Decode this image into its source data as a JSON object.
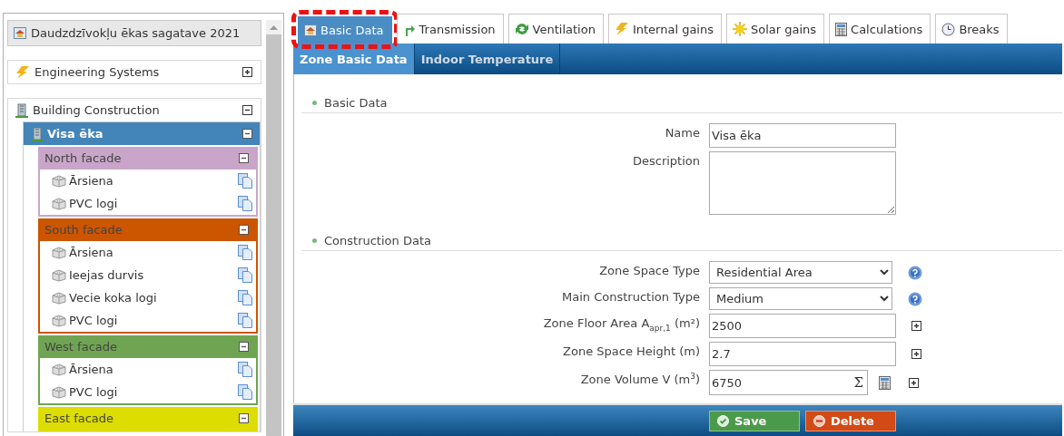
{
  "sidebar": {
    "project_button": "Daudzdzīvokļu ēkas sagatave 2021",
    "panels": [
      {
        "label": "Engineering Systems",
        "kind": "bolt",
        "expanded": false
      },
      {
        "label": "Building Construction",
        "kind": "building",
        "expanded": true,
        "children": [
          {
            "label": "Visa ēka",
            "color": "#4385b9",
            "expanded": true,
            "children": [
              {
                "label": "North facade",
                "color": "#c9a6c9",
                "expanded": true,
                "children": [
                  {
                    "label": "Ārsiena"
                  },
                  {
                    "label": "PVC logi"
                  }
                ]
              },
              {
                "label": "South facade",
                "color": "#cc5500",
                "expanded": true,
                "children": [
                  {
                    "label": "Ārsiena"
                  },
                  {
                    "label": "Ieejas durvis"
                  },
                  {
                    "label": "Vecie koka logi"
                  },
                  {
                    "label": "PVC logi"
                  }
                ]
              },
              {
                "label": "West facade",
                "color": "#6fa552",
                "expanded": true,
                "children": [
                  {
                    "label": "Ārsiena"
                  },
                  {
                    "label": "PVC logi"
                  }
                ]
              },
              {
                "label": "East facade",
                "color": "#dddd00",
                "expanded": true
              }
            ]
          }
        ]
      }
    ]
  },
  "tabs": [
    {
      "label": "Basic Data",
      "kind": "house",
      "selected": true,
      "highlighted": true
    },
    {
      "label": "Transmission",
      "kind": "turn",
      "selected": false,
      "highlighted": false
    },
    {
      "label": "Ventilation",
      "kind": "cycle",
      "selected": false,
      "highlighted": false
    },
    {
      "label": "Internal gains",
      "kind": "bolt",
      "selected": false,
      "highlighted": false
    },
    {
      "label": "Solar gains",
      "kind": "sun",
      "selected": false,
      "highlighted": false
    },
    {
      "label": "Calculations",
      "kind": "calc",
      "selected": false,
      "highlighted": false
    },
    {
      "label": "Breaks",
      "kind": "clock",
      "selected": false,
      "highlighted": false
    }
  ],
  "subtabs": [
    {
      "label": "Zone Basic Data",
      "selected": true
    },
    {
      "label": "Indoor Temperature",
      "selected": false
    }
  ],
  "sections": [
    {
      "title": "Basic Data",
      "fields": [
        {
          "kind": "text",
          "label": "Name",
          "value": "Visa ēka"
        },
        {
          "kind": "textarea",
          "label": "Description"
        }
      ]
    },
    {
      "title": "Construction Data",
      "fields": [
        {
          "kind": "select",
          "label": "Zone Space Type",
          "value": "Residential Area",
          "help": true
        },
        {
          "kind": "select",
          "label": "Main Construction Type",
          "value": "Medium",
          "help": true
        },
        {
          "kind": "text",
          "label": "Zone Floor Area A$_{apr,1}$ (m²)",
          "value": "2500",
          "expand": true
        },
        {
          "kind": "text",
          "label": "Zone Space Height (m)",
          "value": "2.7",
          "expand": true
        },
        {
          "kind": "formula",
          "label": "Zone Volume V (m$^{3}$)",
          "value": "6750",
          "sum_button": "Σ",
          "expand": true
        }
      ]
    }
  ],
  "footer": {
    "buttons": [
      {
        "label": "Save",
        "kind": "save"
      },
      {
        "label": "Delete",
        "kind": "delete"
      }
    ]
  }
}
